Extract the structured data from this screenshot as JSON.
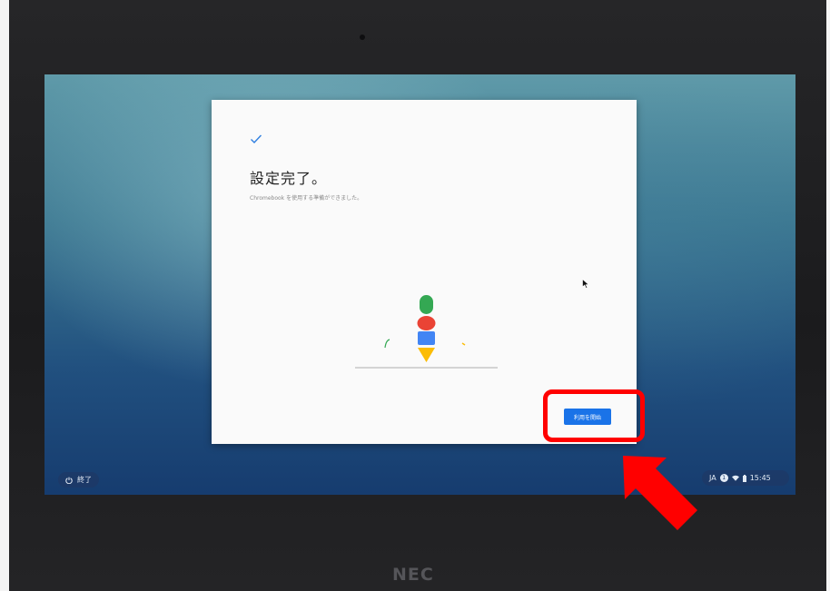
{
  "dialog": {
    "title": "設定完了。",
    "subtitle": "Chromebook を使用する準備ができました。",
    "start_button_label": "利用を開始"
  },
  "shelf": {
    "shutdown_label": "終了",
    "tray": {
      "language": "JA",
      "notification_count": "1",
      "time": "15:45"
    }
  },
  "device": {
    "brand": "NEC"
  },
  "colors": {
    "accent_blue": "#1a73e8",
    "annotation_red": "#ff0000",
    "illus_green": "#34a853",
    "illus_red": "#ea4335",
    "illus_blue": "#4285f4",
    "illus_yellow": "#fbbc05"
  },
  "icons": [
    "checkmark-icon",
    "power-icon",
    "notification-badge-icon",
    "wifi-icon",
    "battery-icon",
    "mouse-cursor-icon"
  ]
}
